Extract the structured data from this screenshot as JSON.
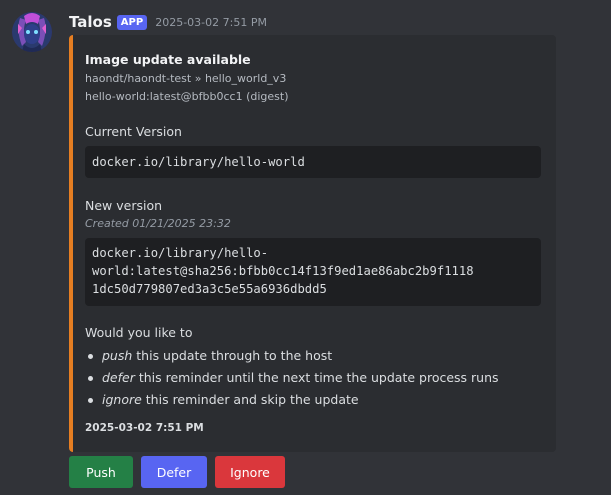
{
  "author": {
    "name": "Talos",
    "badge": "APP",
    "timestamp": "2025-03-02 7:51 PM"
  },
  "colors": {
    "accent_border": "#e67e22",
    "push_button": "#248046",
    "defer_button": "#5865f2",
    "ignore_button": "#da373c",
    "app_badge": "#5865f2"
  },
  "embed": {
    "title": "Image update available",
    "repo": "haondt/haondt-test » hello_world_v3",
    "digest_ref": "hello-world:latest@bfbb0cc1 (digest)",
    "current_version_label": "Current Version",
    "current_version_lines": [
      "docker.io/library/hello-world"
    ],
    "new_version_label": "New version",
    "new_version_created": "Created 01/21/2025 23:32",
    "new_version_lines": [
      "docker.io/library/hello-",
      "world:latest@sha256:bfbb0cc14f13f9ed1ae86abc2b9f1118",
      "1dc50d779807ed3a3c5e55a6936dbdd5"
    ],
    "prompt": "Would you like to",
    "options": [
      {
        "verb": "push",
        "rest": " this update through to the host"
      },
      {
        "verb": "defer",
        "rest": " this reminder until the next time the update process runs"
      },
      {
        "verb": "ignore",
        "rest": " this reminder and skip the update"
      }
    ],
    "footer_timestamp": "2025-03-02 7:51 PM"
  },
  "buttons": {
    "push_label": "Push",
    "defer_label": "Defer",
    "ignore_label": "Ignore"
  }
}
